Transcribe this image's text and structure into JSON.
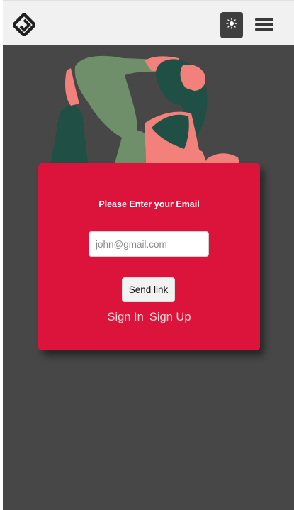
{
  "header": {
    "logo_icon": "diamond-logo-icon",
    "theme_toggle_icon": "sun-icon",
    "menu_icon": "hamburger-menu-icon"
  },
  "illustration": {
    "icon": "yoga-woman-illustration"
  },
  "card": {
    "title": "Please Enter your Email",
    "email_placeholder": "john@gmail.com",
    "email_value": "",
    "send_label": "Send link",
    "signin_label": "Sign In",
    "signup_label": "Sign Up"
  },
  "colors": {
    "navbar_bg": "#f1f1f1",
    "page_bg": "#474747",
    "card_bg": "#dc143c",
    "theme_button_bg": "#3f3f3f",
    "link_color": "#ffd3d3"
  }
}
